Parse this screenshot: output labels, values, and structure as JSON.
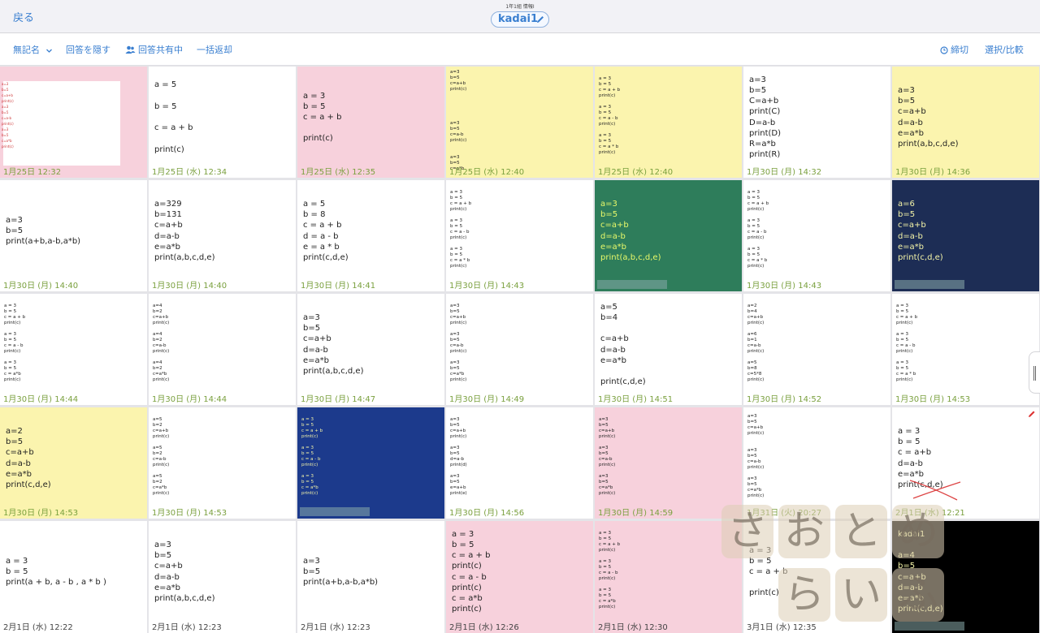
{
  "header": {
    "back_label": "戻る",
    "subtitle": "1年1組 情報I",
    "title": "kadai1"
  },
  "toolbar": {
    "anonymous_label": "無記名",
    "hide_answers_label": "回答を隠す",
    "sharing_label": "回答共有中",
    "bulk_return_label": "一括返却",
    "deadline_label": "締切",
    "select_compare_label": "選択/比較"
  },
  "colors": {
    "accent": "#3a7fd0",
    "timestamp": "#7aa03e",
    "pink": "#f7d1dc",
    "yellow": "#fbf4ae",
    "green": "#2e7d5b",
    "navy": "#1d2d55",
    "blue": "#1c3a8c",
    "black": "#000000",
    "white": "#ffffff"
  },
  "watermark": {
    "text": "さおとめらいふ"
  },
  "cards": [
    {
      "bg": "pink",
      "size": "thumb",
      "text": "a=3\nb=5\nc=a+b\nprint(c)\na=3\nb=5\nc=a-b\nprint(c)\na=3\nb=5\nc=a*b\nprint(c)",
      "timestamp": "1月25日 12:32"
    },
    {
      "bg": "white",
      "size": "big",
      "text": "a = 5\n\nb = 5\n\nc = a + b\n\nprint(c)",
      "timestamp": "1月25日 (水) 12:34"
    },
    {
      "bg": "pink",
      "size": "big",
      "text": "a = 3\nb = 5\nc = a + b\n\nprint(c)",
      "timestamp": "1月25日 (水) 12:35"
    },
    {
      "bg": "yellow",
      "size": "small",
      "text": "a=3\nb=5\nc=a+b\nprint(c)\n\n\n\n\n\na=3\nb=5\nc=a-b\nprint(c)\n\n\na=3\nb=5\nc=a*b",
      "timestamp": "1月25日 (水) 12:40"
    },
    {
      "bg": "yellow",
      "size": "small",
      "text": "a = 3\nb = 5\nc = a + b\nprint(c)\n\na = 3\nb = 5\nc = a - b\nprint(c)\n\na = 3\nb = 5\nc = a * b\nprint(c)",
      "timestamp": "1月25日 (水) 12:40"
    },
    {
      "bg": "white",
      "size": "big",
      "text": "a=3\nb=5\nC=a+b\nprint(C)\nD=a-b\nprint(D)\nR=a*b\nprint(R)",
      "timestamp": "1月30日 (月) 14:32"
    },
    {
      "bg": "yellow",
      "size": "big",
      "text": "a=3\nb=5\nc=a+b\nd=a-b\ne=a*b\nprint(a,b,c,d,e)",
      "timestamp": "1月30日 (月) 14:36"
    },
    {
      "bg": "white",
      "size": "big",
      "text": "a=3\nb=5\nprint(a+b,a-b,a*b)",
      "timestamp": "1月30日 (月) 14:40"
    },
    {
      "bg": "white",
      "size": "big",
      "text": "a=329\nb=131\nc=a+b\nd=a-b\ne=a*b\nprint(a,b,c,d,e)",
      "timestamp": "1月30日 (月) 14:40"
    },
    {
      "bg": "white",
      "size": "big",
      "text": "a = 5\nb = 8\nc = a + b\nd = a - b\ne = a * b\nprint(c,d,e)",
      "timestamp": "1月30日 (月) 14:41"
    },
    {
      "bg": "white",
      "size": "small",
      "text": "a = 3\nb = 5\nc = a + b\nprint(c)\n\na = 3\nb = 5\nc = a - b\nprint(c)\n\na = 3\nb = 5\nc = a * b\nprint(c)",
      "timestamp": "1月30日 (月) 14:43"
    },
    {
      "bg": "green",
      "size": "big",
      "text": "a=3\nb=5\nc=a+b\nd=a-b\ne=a*b\nprint(a,b,c,d,e)",
      "timestamp": ""
    },
    {
      "bg": "white",
      "size": "small",
      "text": "a = 3\nb = 5\nc = a + b\nprint(c)\n\na = 3\nb = 5\nc = a - b\nprint(c)\n\na = 3\nb = 5\nc = a * b\nprint(c)",
      "timestamp": "1月30日 (月) 14:43"
    },
    {
      "bg": "navy",
      "size": "big",
      "text": "a=6\nb=5\nc=a+b\nd=a-b\ne=a*b\nprint(c,d,e)",
      "timestamp": ""
    },
    {
      "bg": "white",
      "size": "small",
      "text": "a = 3\nb = 5\nc = a + b\nprint(c)\n\na = 3\nb = 5\nc = a - b\nprint(c)\n\na = 3\nb = 5\nc = a*b\nprint(c)",
      "timestamp": "1月30日 (月) 14:44"
    },
    {
      "bg": "white",
      "size": "small",
      "text": "a=4\nb=2\nc=a+b\nprint(c)\n\na=4\nb=2\nc=a-b\nprint(c)\n\na=4\nb=2\nc=a*b\nprint(c)",
      "timestamp": "1月30日 (月) 14:44"
    },
    {
      "bg": "white",
      "size": "big",
      "text": "a=3\nb=5\nc=a+b\nd=a-b\ne=a*b\nprint(a,b,c,d,e)",
      "timestamp": "1月30日 (月) 14:47"
    },
    {
      "bg": "white",
      "size": "small",
      "text": "a=3\nb=5\nc=a+b\nprint(c)\n\na=3\nb=5\nc=a-b\nprint(c)\n\na=3\nb=5\nc=a*b\nprint(c)",
      "timestamp": "1月30日 (月) 14:49"
    },
    {
      "bg": "white",
      "size": "big",
      "text": "a=5\nb=4\n\nc=a+b\nd=a-b\ne=a*b\n\nprint(c,d,e)",
      "timestamp": "1月30日 (月) 14:51"
    },
    {
      "bg": "white",
      "size": "small",
      "text": "a=2\nb=4\nc=a+b\nprint(c)\n\na=6\nb=1\nc=a-b\nprint(c)\n\na=5\nb=8\nc=5*8\nprint(c)",
      "timestamp": "1月30日 (月) 14:52"
    },
    {
      "bg": "white",
      "size": "small",
      "text": "a = 3\nb = 5\nc = a + b\nprint(c)\n\na = 3\nb = 5\nc = a - b\nprint(c)\n\na = 3\nb = 5\nc = a * b\nprint(c)",
      "timestamp": "1月30日 (月) 14:53"
    },
    {
      "bg": "yellow",
      "size": "big",
      "text": "a=2\nb=5\nc=a+b\nd=a-b\ne=a*b\nprint(c,d,e)",
      "timestamp": "1月30日 (月) 14:53"
    },
    {
      "bg": "white",
      "size": "small",
      "text": "a=5\nb=2\nc=a+b\nprint(c)\n\na=5\nb=2\nc=a-b\nprint(c)\n\na=5\nb=2\nc=a*b\nprint(c)",
      "timestamp": "1月30日 (月) 14:53"
    },
    {
      "bg": "blue",
      "size": "small",
      "text": "a = 3\nb = 5\nc = a + b\nprint(c)\n\na = 3\nb = 5\nc = a - b\nprint(c)\n\na = 3\nb = 5\nc = a*b\nprint(c)",
      "timestamp": ""
    },
    {
      "bg": "white",
      "size": "small",
      "text": "a=3\nb=5\nc=a+b\nprint(c)\n\na=3\nb=5\nd=a-b\nprint(d)\n\na=3\nb=5\ne=a+b\nprint(e)",
      "timestamp": "1月30日 (月) 14:56"
    },
    {
      "bg": "pink",
      "size": "small",
      "text": "a=3\nb=5\nc=a+b\nprint(c)\n\na=3\nb=5\nc=a-b\nprint(c)\n\na=3\nb=5\nc=a*b\nprint(c)",
      "timestamp": "1月30日 (月) 14:59"
    },
    {
      "bg": "white",
      "size": "small",
      "text": "a=3\nb=5\nc=a+b\nprint(c)\n\n\na=3\nb=5\nc=a-b\nprint(c)\n\na=3\nb=5\nc=a*b\nprint(c)",
      "timestamp": "1月31日 (火) 20:27"
    },
    {
      "bg": "white",
      "size": "big",
      "text": "a = 3\nb = 5\nc = a+b\nd=a-b\ne=a*b\nprint(c,d,e)",
      "timestamp": "2月1日 (水) 12:21"
    },
    {
      "bg": "white",
      "size": "big",
      "text": "a = 3\nb = 5\nprint(a + b, a - b , a * b )",
      "timestamp": "2月1日 (水) 12:22"
    },
    {
      "bg": "white",
      "size": "big",
      "text": "a=3\nb=5\nc=a+b\nd=a-b\ne=a*b\nprint(a,b,c,d,e)",
      "timestamp": "2月1日 (水) 12:23"
    },
    {
      "bg": "white",
      "size": "big",
      "text": "a=3\nb=5\nprint(a+b,a-b,a*b)",
      "timestamp": "2月1日 (水) 12:23"
    },
    {
      "bg": "pink",
      "size": "big",
      "text": "a = 3\nb = 5\nc = a + b\nprint(c)\nc = a - b\nprint(c)\nc = a*b\nprint(c)",
      "timestamp": "2月1日 (水) 12:26"
    },
    {
      "bg": "pink",
      "size": "small",
      "text": "a = 3\nb = 5\nc = a + b\nprint(c)\n\na = 3\nb = 5\nc = a - b\nprint(c)\n\na = 3\nb = 5\nc = a*b\nprint(c)",
      "timestamp": "2月1日 (水) 12:30"
    },
    {
      "bg": "white",
      "size": "big",
      "text": "a = 3\nb = 5\nc = a + b\n\nprint(c)",
      "timestamp": "3月1日 (水) 12:35"
    },
    {
      "bg": "black",
      "size": "big",
      "text": "kadai1\n\na=4\nb=5\nc=a+b\nd=a-b\ne=a*b\nprint(c,d,e)",
      "timestamp": ""
    }
  ]
}
